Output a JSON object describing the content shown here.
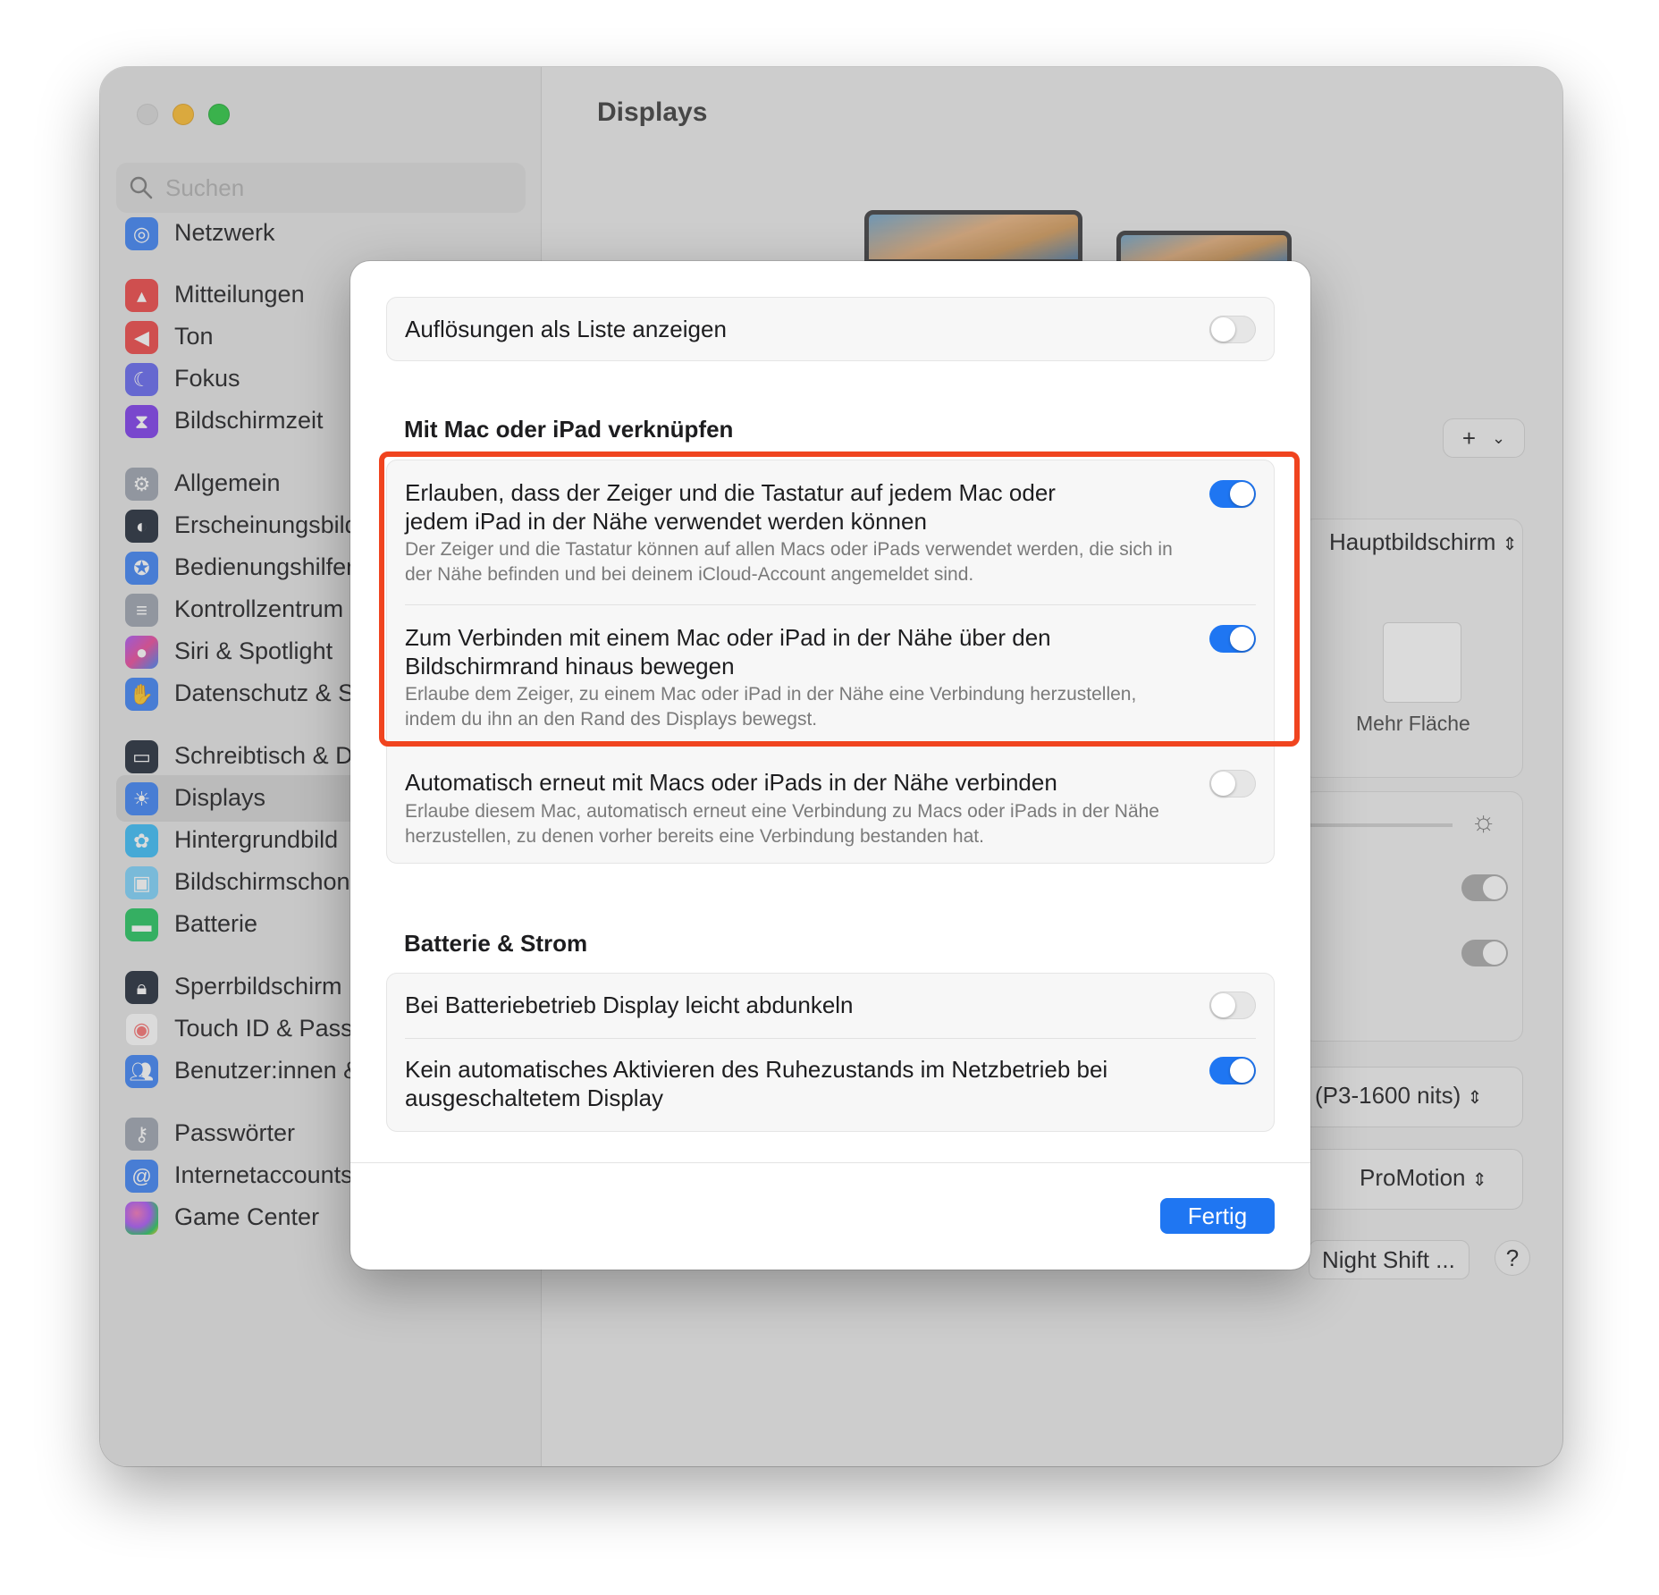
{
  "window": {
    "title": "Displays",
    "search_placeholder": "Suchen"
  },
  "sidebar": {
    "items": [
      {
        "label": "Netzwerk",
        "icon": "globe-icon",
        "color": "#3b82f6"
      },
      {
        "label": "Mitteilungen",
        "icon": "bell-icon",
        "color": "#ef4444"
      },
      {
        "label": "Ton",
        "icon": "speaker-icon",
        "color": "#ef4444"
      },
      {
        "label": "Fokus",
        "icon": "moon-icon",
        "color": "#6366f1"
      },
      {
        "label": "Bildschirmzeit",
        "icon": "hourglass-icon",
        "color": "#7c3aed"
      },
      {
        "label": "Allgemein",
        "icon": "gear-icon",
        "color": "#9ca3af"
      },
      {
        "label": "Erscheinungsbild",
        "icon": "appearance-icon",
        "color": "#1f2937"
      },
      {
        "label": "Bedienungshilfen",
        "icon": "accessibility-icon",
        "color": "#3b82f6"
      },
      {
        "label": "Kontrollzentrum",
        "icon": "switches-icon",
        "color": "#9ca3af"
      },
      {
        "label": "Siri & Spotlight",
        "icon": "siri-icon",
        "color": "#a855f7"
      },
      {
        "label": "Datenschutz & Sicherheit",
        "icon": "hand-icon",
        "color": "#3b82f6"
      },
      {
        "label": "Schreibtisch & Dock",
        "icon": "dock-icon",
        "color": "#1f2937"
      },
      {
        "label": "Displays",
        "icon": "sun-icon",
        "color": "#3b82f6",
        "selected": true
      },
      {
        "label": "Hintergrundbild",
        "icon": "flower-icon",
        "color": "#38bdf8"
      },
      {
        "label": "Bildschirmschoner",
        "icon": "screensaver-icon",
        "color": "#7dd3fc"
      },
      {
        "label": "Batterie",
        "icon": "battery-icon",
        "color": "#22c55e"
      },
      {
        "label": "Sperrbildschirm",
        "icon": "lock-icon",
        "color": "#1f2937"
      },
      {
        "label": "Touch ID & Passwort",
        "icon": "fingerprint-icon",
        "color": "#f87171"
      },
      {
        "label": "Benutzer:innen & Gruppen",
        "icon": "users-icon",
        "color": "#3b82f6"
      },
      {
        "label": "Passwörter",
        "icon": "key-icon",
        "color": "#9ca3af"
      },
      {
        "label": "Internetaccounts",
        "icon": "at-icon",
        "color": "#3b82f6"
      },
      {
        "label": "Game Center",
        "icon": "gamecenter-icon",
        "color": "#f472b6"
      }
    ]
  },
  "background": {
    "main_display_select": "Hauptbildschirm",
    "more_space_label": "Mehr Fläche",
    "preset_select": "(P3-1600 nits)",
    "refresh_select": "ProMotion",
    "night_shift_button": "Night Shift ...",
    "help_button": "?",
    "add_button": "+"
  },
  "sheet": {
    "top_row": {
      "title": "Auflösungen als Liste anzeigen",
      "enabled": false
    },
    "section_link": {
      "heading": "Mit Mac oder iPad verknüpfen",
      "rows": [
        {
          "title": "Erlauben, dass der Zeiger und die Tastatur auf jedem Mac oder jedem iPad in der Nähe verwendet werden können",
          "desc": "Der Zeiger und die Tastatur können auf allen Macs oder iPads verwendet werden, die sich in der Nähe befinden und bei deinem iCloud-Account angemeldet sind.",
          "enabled": true
        },
        {
          "title": "Zum Verbinden mit einem Mac oder iPad in der Nähe über den Bildschirmrand hinaus bewegen",
          "desc": "Erlaube dem Zeiger, zu einem Mac oder iPad in der Nähe eine Verbindung herzustellen, indem du ihn an den Rand des Displays bewegst.",
          "enabled": true
        },
        {
          "title": "Automatisch erneut mit Macs oder iPads in der Nähe verbinden",
          "desc": "Erlaube diesem Mac, automatisch erneut eine Verbindung zu Macs oder iPads in der Nähe herzustellen, zu denen vorher bereits eine Verbindung bestanden hat.",
          "enabled": false
        }
      ]
    },
    "section_battery": {
      "heading": "Batterie & Strom",
      "rows": [
        {
          "title": "Bei Batteriebetrieb Display leicht abdunkeln",
          "enabled": false
        },
        {
          "title": "Kein automatisches Aktivieren des Ruhezustands im Netzbetrieb bei ausgeschaltetem Display",
          "enabled": true
        }
      ]
    },
    "done_button": "Fertig"
  },
  "colors": {
    "accent": "#1f76f2",
    "highlight": "#f0441f"
  }
}
